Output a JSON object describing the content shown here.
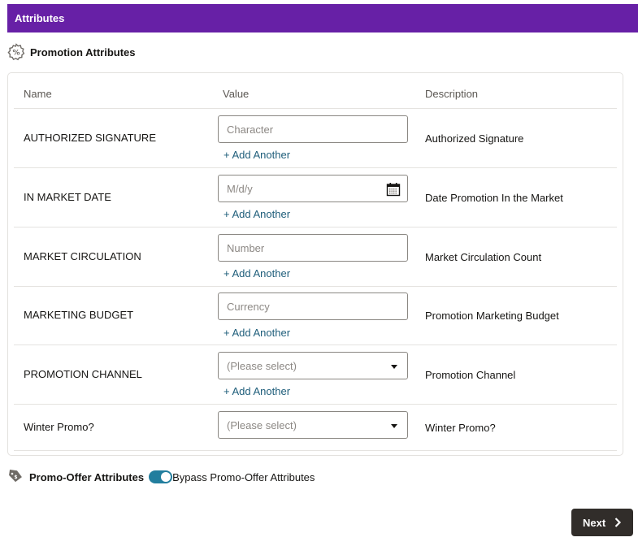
{
  "header": {
    "title": "Attributes"
  },
  "promotion_section": {
    "title": "Promotion Attributes",
    "icon": "percent-badge-icon"
  },
  "table": {
    "columns": [
      "Name",
      "Value",
      "Description"
    ],
    "rows": [
      {
        "name": "AUTHORIZED SIGNATURE",
        "type": "text",
        "placeholder": "Character",
        "add_label": "+ Add Another",
        "description": "Authorized Signature"
      },
      {
        "name": "IN MARKET DATE",
        "type": "date",
        "placeholder": "M/d/y",
        "add_label": "+ Add Another",
        "description": "Date Promotion In the Market",
        "icon": "calendar-icon"
      },
      {
        "name": "MARKET CIRCULATION",
        "type": "number",
        "placeholder": "Number",
        "add_label": "+ Add Another",
        "description": "Market Circulation Count"
      },
      {
        "name": "MARKETING BUDGET",
        "type": "currency",
        "placeholder": "Currency",
        "add_label": "+ Add Another",
        "description": "Promotion Marketing Budget"
      },
      {
        "name": "PROMOTION CHANNEL",
        "type": "select",
        "placeholder": "(Please select)",
        "add_label": "+ Add Another",
        "description": "Promotion Channel"
      },
      {
        "name": "Winter Promo?",
        "type": "select",
        "placeholder": "(Please select)",
        "description": "Winter Promo?"
      }
    ]
  },
  "offer_section": {
    "title": "Promo-Offer Attributes",
    "icon": "tag-icon",
    "toggle_label": "Bypass Promo-Offer Attributes",
    "toggle_on": true
  },
  "footer": {
    "next_label": "Next"
  },
  "colors": {
    "header_bg": "#6720a6",
    "link": "#1e5d7a",
    "toggle": "#227e9e",
    "button_bg": "#312d2a"
  }
}
